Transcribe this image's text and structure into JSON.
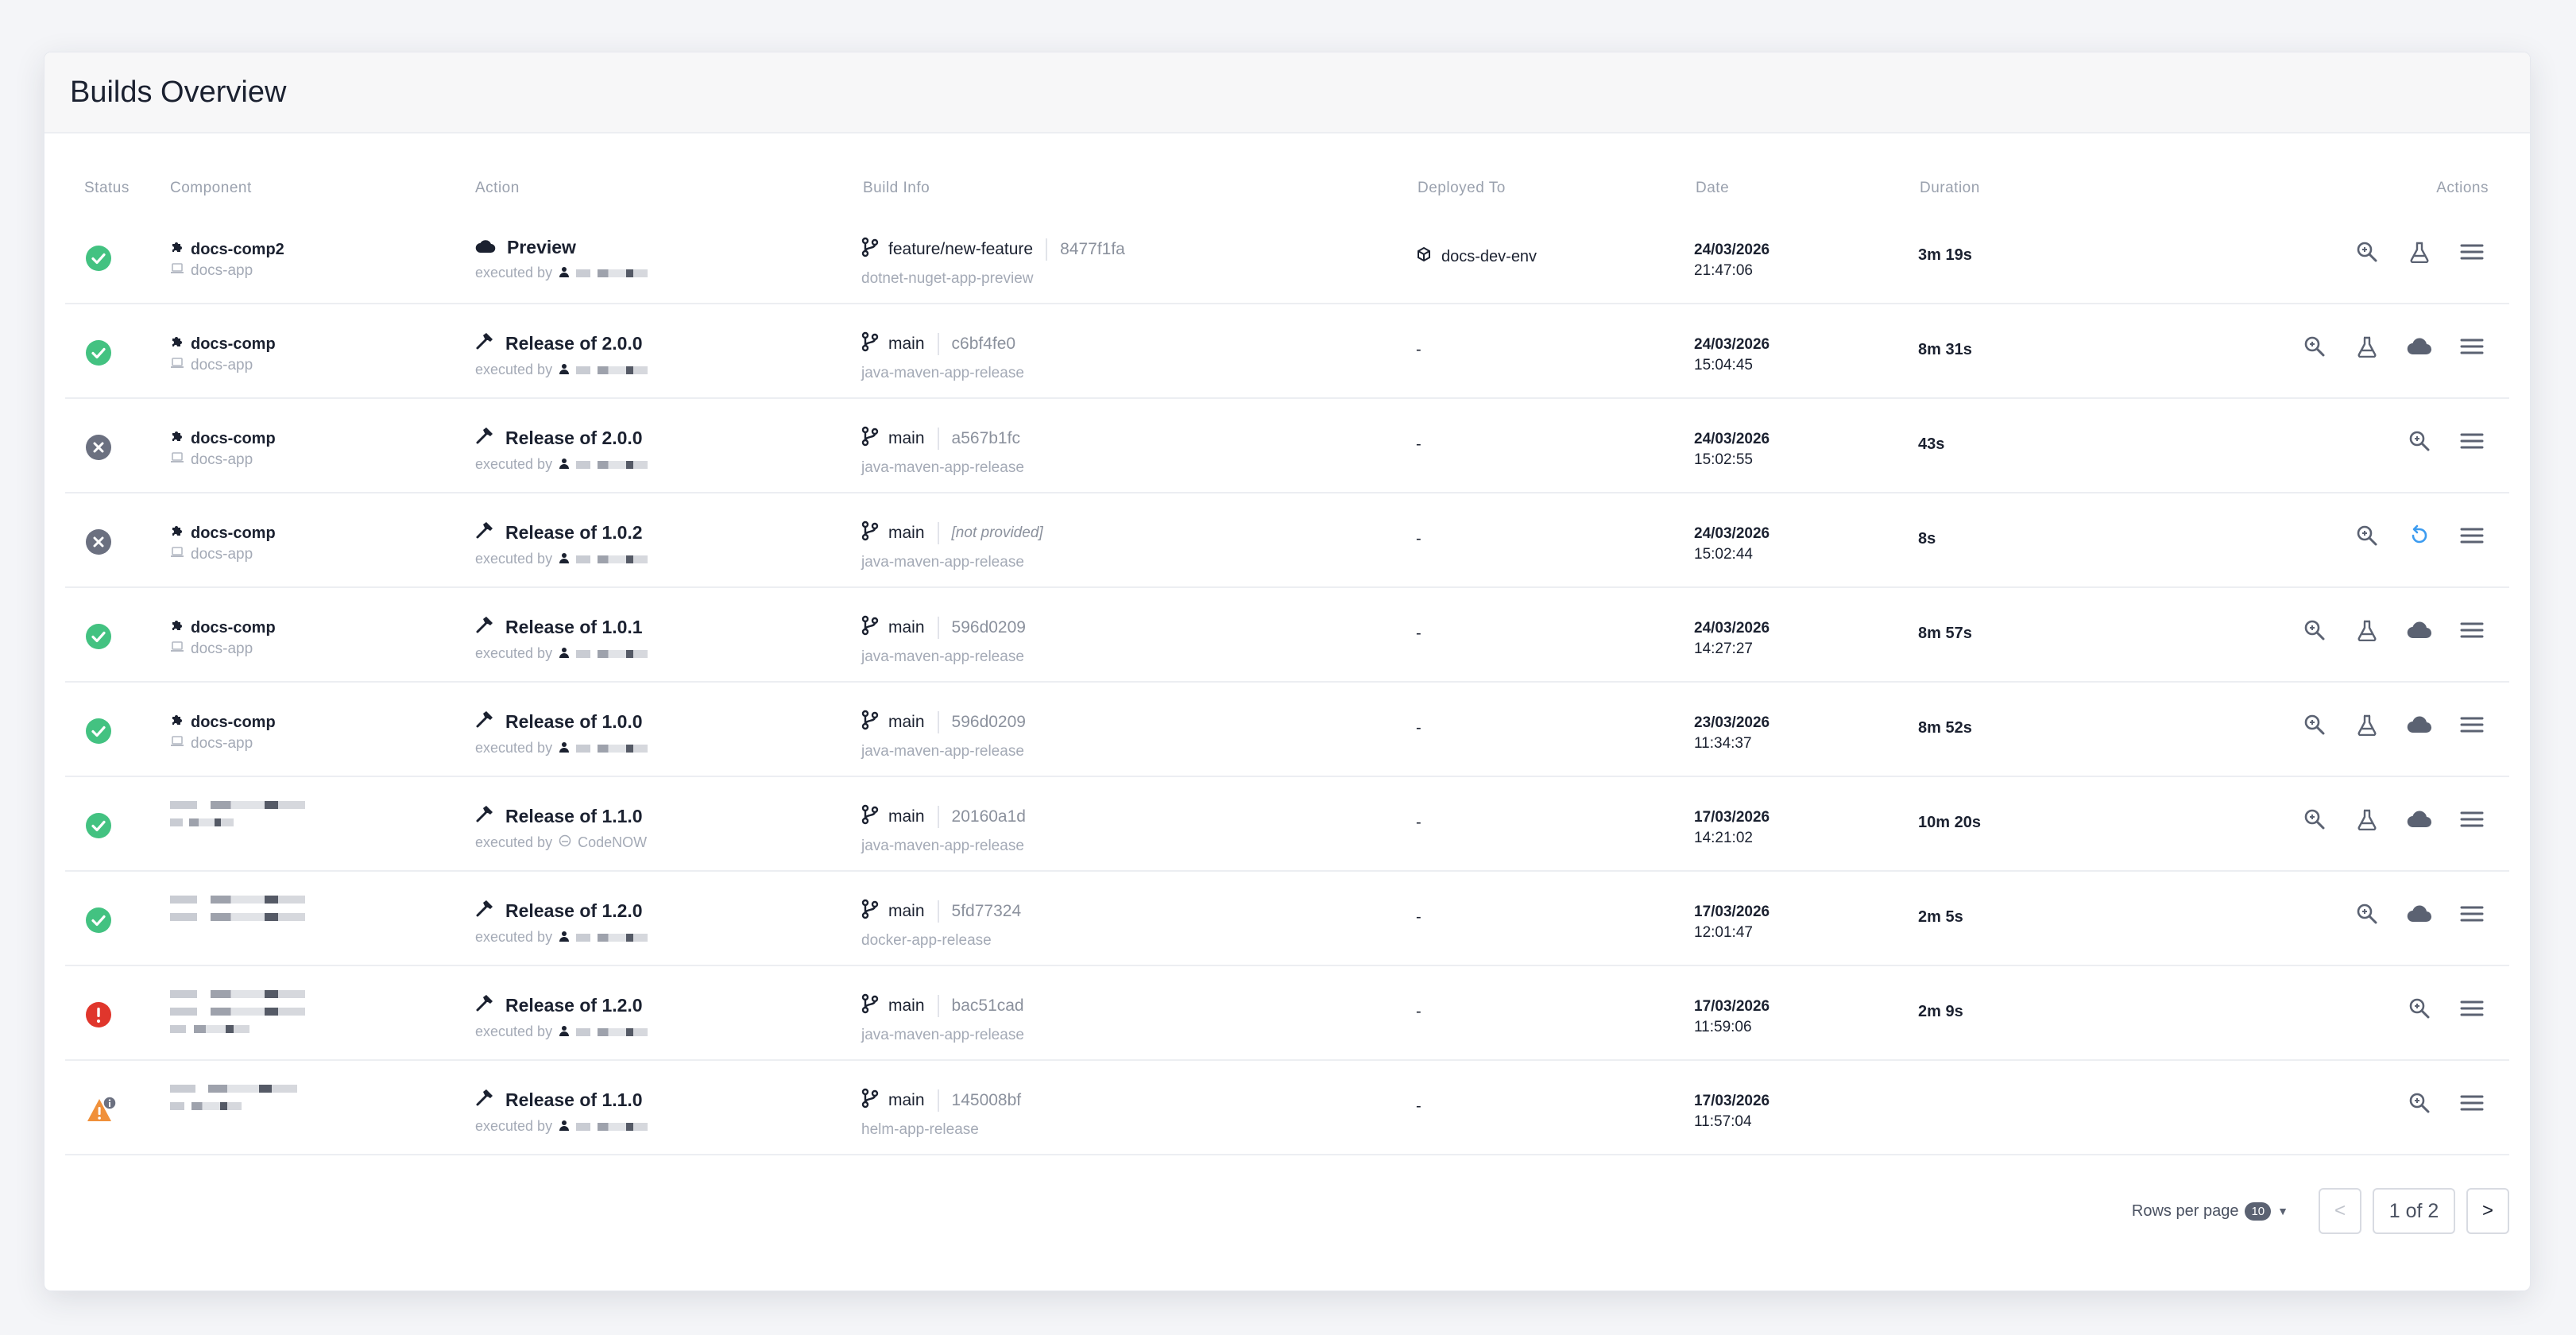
{
  "header": {
    "title": "Builds Overview"
  },
  "columns": {
    "status": "Status",
    "component": "Component",
    "action": "Action",
    "build_info": "Build Info",
    "deployed_to": "Deployed To",
    "date": "Date",
    "duration": "Duration",
    "actions": "Actions"
  },
  "executed_by_label": "executed by",
  "rows": [
    {
      "status": "success",
      "component": "docs-comp2",
      "app": "docs-app",
      "action_icon": "cloud-icon",
      "action": "Preview",
      "executor_icon": "user-icon",
      "executor": "",
      "branch": "feature/new-feature",
      "sha": "8477f1fa",
      "pipeline": "dotnet-nuget-app-preview",
      "deployed": "docs-dev-env",
      "date": "24/03/2026",
      "time": "21:47:06",
      "duration": "3m 19s",
      "actions": [
        "search",
        "flask",
        "menu"
      ]
    },
    {
      "status": "success",
      "component": "docs-comp",
      "app": "docs-app",
      "action_icon": "hammer-icon",
      "action": "Release of 2.0.0",
      "executor_icon": "user-icon",
      "executor": "",
      "branch": "main",
      "sha": "c6bf4fe0",
      "pipeline": "java-maven-app-release",
      "deployed": "-",
      "date": "24/03/2026",
      "time": "15:04:45",
      "duration": "8m 31s",
      "actions": [
        "search",
        "flask",
        "cloud",
        "menu"
      ]
    },
    {
      "status": "cancelled",
      "component": "docs-comp",
      "app": "docs-app",
      "action_icon": "hammer-icon",
      "action": "Release of 2.0.0",
      "executor_icon": "user-icon",
      "executor": "",
      "branch": "main",
      "sha": "a567b1fc",
      "pipeline": "java-maven-app-release",
      "deployed": "-",
      "date": "24/03/2026",
      "time": "15:02:55",
      "duration": "43s",
      "actions": [
        "search",
        "menu"
      ]
    },
    {
      "status": "cancelled",
      "component": "docs-comp",
      "app": "docs-app",
      "action_icon": "hammer-icon",
      "action": "Release of 1.0.2",
      "executor_icon": "user-icon",
      "executor": "",
      "branch": "main",
      "sha": "[not provided]",
      "sha_italic": true,
      "pipeline": "java-maven-app-release",
      "deployed": "-",
      "date": "24/03/2026",
      "time": "15:02:44",
      "duration": "8s",
      "actions": [
        "search",
        "retry",
        "menu"
      ]
    },
    {
      "status": "success",
      "component": "docs-comp",
      "app": "docs-app",
      "action_icon": "hammer-icon",
      "action": "Release of 1.0.1",
      "executor_icon": "user-icon",
      "executor": "",
      "branch": "main",
      "sha": "596d0209",
      "pipeline": "java-maven-app-release",
      "deployed": "-",
      "date": "24/03/2026",
      "time": "14:27:27",
      "duration": "8m 57s",
      "actions": [
        "search",
        "flask",
        "cloud",
        "menu"
      ]
    },
    {
      "status": "success",
      "component": "docs-comp",
      "app": "docs-app",
      "action_icon": "hammer-icon",
      "action": "Release of 1.0.0",
      "executor_icon": "user-icon",
      "executor": "",
      "branch": "main",
      "sha": "596d0209",
      "pipeline": "java-maven-app-release",
      "deployed": "-",
      "date": "23/03/2026",
      "time": "11:34:37",
      "duration": "8m 52s",
      "actions": [
        "search",
        "flask",
        "cloud",
        "menu"
      ]
    },
    {
      "status": "success",
      "component": "",
      "app": "",
      "redacted": true,
      "action_icon": "hammer-icon",
      "action": "Release of 1.1.0",
      "executor_icon": "bot-icon",
      "executor": "CodeNOW",
      "branch": "main",
      "sha": "20160a1d",
      "pipeline": "java-maven-app-release",
      "deployed": "-",
      "date": "17/03/2026",
      "time": "14:21:02",
      "duration": "10m 20s",
      "actions": [
        "search",
        "flask",
        "cloud",
        "menu"
      ]
    },
    {
      "status": "success",
      "component": "",
      "app": "",
      "redacted": true,
      "action_icon": "hammer-icon",
      "action": "Release of 1.2.0",
      "executor_icon": "user-icon",
      "executor": "",
      "branch": "main",
      "sha": "5fd77324",
      "pipeline": "docker-app-release",
      "deployed": "-",
      "date": "17/03/2026",
      "time": "12:01:47",
      "duration": "2m 5s",
      "actions": [
        "search",
        "cloud",
        "menu"
      ]
    },
    {
      "status": "error",
      "component": "",
      "app": "",
      "redacted": true,
      "action_icon": "hammer-icon",
      "action": "Release of 1.2.0",
      "executor_icon": "user-icon",
      "executor": "",
      "branch": "main",
      "sha": "bac51cad",
      "pipeline": "java-maven-app-release",
      "deployed": "-",
      "date": "17/03/2026",
      "time": "11:59:06",
      "duration": "2m 9s",
      "actions": [
        "search",
        "menu"
      ]
    },
    {
      "status": "warning",
      "component": "",
      "app": "",
      "redacted": true,
      "action_icon": "hammer-icon",
      "action": "Release of 1.1.0",
      "executor_icon": "user-icon",
      "executor": "",
      "branch": "main",
      "sha": "145008bf",
      "pipeline": "helm-app-release",
      "deployed": "-",
      "date": "17/03/2026",
      "time": "11:57:04",
      "duration": "",
      "actions": [
        "search",
        "menu"
      ]
    }
  ],
  "pagination": {
    "rows_per_page_label": "Rows per page",
    "rows_per_page_value": "10",
    "prev": "<",
    "page": "1 of 2",
    "next": ">"
  },
  "colors": {
    "success": "#43c281",
    "cancelled": "#6b7080",
    "error": "#e0362c",
    "warning": "#f0903a",
    "retry": "#3d9cf0",
    "icon": "#5b6272"
  }
}
